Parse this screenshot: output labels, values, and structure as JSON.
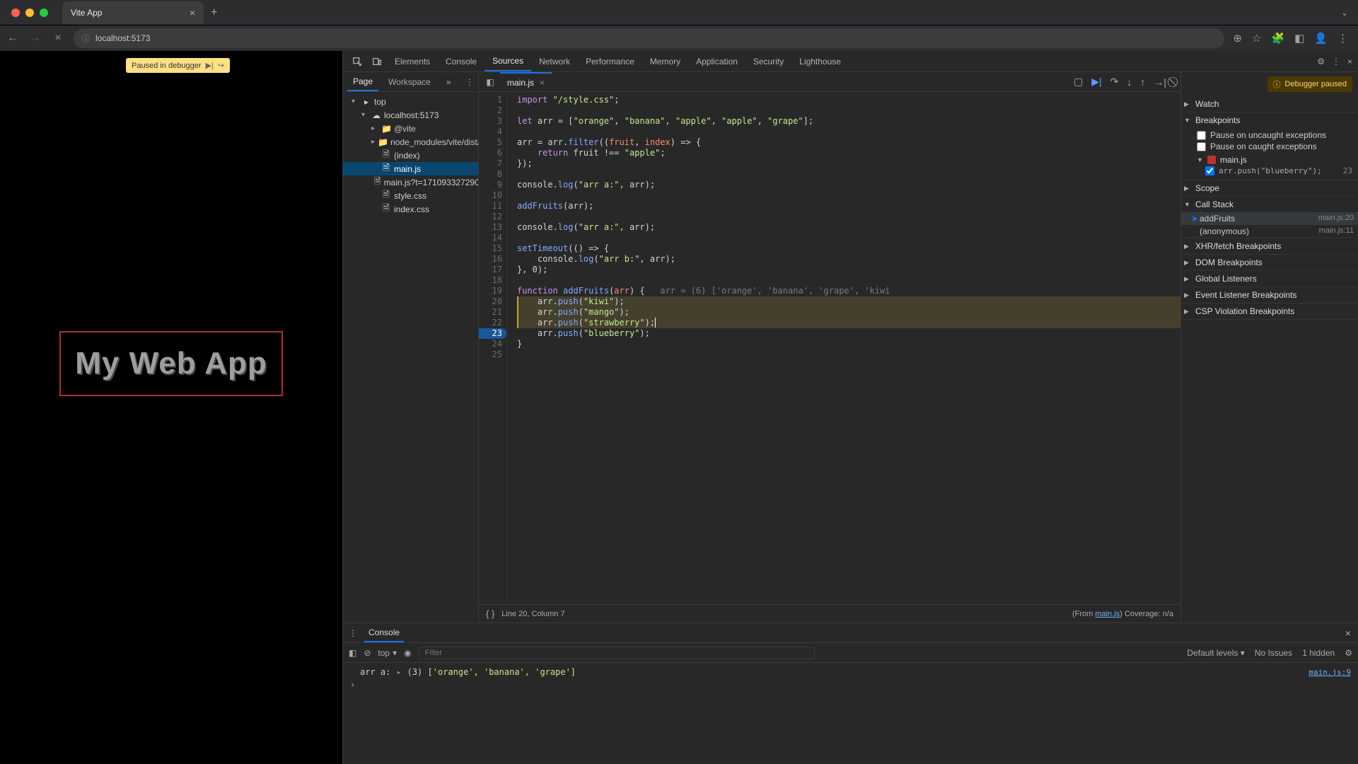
{
  "browser": {
    "tab_title": "Vite App",
    "url": "localhost:5173",
    "new_tab": "+"
  },
  "page": {
    "pause_badge": "Paused in debugger",
    "heading": "My Web App"
  },
  "devtools": {
    "tabs": [
      "Elements",
      "Console",
      "Sources",
      "Network",
      "Performance",
      "Memory",
      "Application",
      "Security",
      "Lighthouse"
    ],
    "active_tab": "Sources"
  },
  "sources_nav": {
    "tabs": [
      "Page",
      "Workspace"
    ],
    "more": "»",
    "tree": {
      "top": "top",
      "host": "localhost:5173",
      "vite_folder": "@vite",
      "node_modules": "node_modules/vite/dist/c",
      "files": [
        "(index)",
        "main.js",
        "main.js?t=171093327290",
        "style.css",
        "index.css"
      ],
      "selected": "main.js"
    }
  },
  "editor": {
    "tab": "main.js",
    "footer_pos": "Line 20, Column 7",
    "footer_from": "(From ",
    "footer_link": "main.js",
    "footer_cov": ") Coverage: n/a",
    "lines": [
      [
        {
          "t": "import ",
          "c": "kw"
        },
        {
          "t": "\"/style.css\"",
          "c": "str"
        },
        {
          "t": ";",
          "c": "ident"
        }
      ],
      [],
      [
        {
          "t": "let ",
          "c": "kw"
        },
        {
          "t": "arr = [",
          "c": "ident"
        },
        {
          "t": "\"orange\"",
          "c": "str"
        },
        {
          "t": ", ",
          "c": "ident"
        },
        {
          "t": "\"banana\"",
          "c": "str"
        },
        {
          "t": ", ",
          "c": "ident"
        },
        {
          "t": "\"apple\"",
          "c": "str"
        },
        {
          "t": ", ",
          "c": "ident"
        },
        {
          "t": "\"apple\"",
          "c": "str"
        },
        {
          "t": ", ",
          "c": "ident"
        },
        {
          "t": "\"grape\"",
          "c": "str"
        },
        {
          "t": "];",
          "c": "ident"
        }
      ],
      [],
      [
        {
          "t": "arr = arr.",
          "c": "ident"
        },
        {
          "t": "filter",
          "c": "fn"
        },
        {
          "t": "((",
          "c": "ident"
        },
        {
          "t": "fruit",
          "c": "param"
        },
        {
          "t": ", ",
          "c": "ident"
        },
        {
          "t": "index",
          "c": "param"
        },
        {
          "t": ") => {",
          "c": "ident"
        }
      ],
      [
        {
          "t": "    return ",
          "c": "kw"
        },
        {
          "t": "fruit !== ",
          "c": "ident"
        },
        {
          "t": "\"apple\"",
          "c": "str"
        },
        {
          "t": ";",
          "c": "ident"
        }
      ],
      [
        {
          "t": "});",
          "c": "ident"
        }
      ],
      [],
      [
        {
          "t": "console.",
          "c": "ident"
        },
        {
          "t": "log",
          "c": "fn"
        },
        {
          "t": "(",
          "c": "ident"
        },
        {
          "t": "\"arr a:\"",
          "c": "str"
        },
        {
          "t": ", arr);",
          "c": "ident"
        }
      ],
      [],
      [
        {
          "t": "addFruits",
          "c": "fn"
        },
        {
          "t": "(arr);",
          "c": "ident"
        }
      ],
      [],
      [
        {
          "t": "console.",
          "c": "ident"
        },
        {
          "t": "log",
          "c": "fn"
        },
        {
          "t": "(",
          "c": "ident"
        },
        {
          "t": "\"arr a:\"",
          "c": "str"
        },
        {
          "t": ", arr);",
          "c": "ident"
        }
      ],
      [],
      [
        {
          "t": "setTimeout",
          "c": "fn"
        },
        {
          "t": "(() => {",
          "c": "ident"
        }
      ],
      [
        {
          "t": "    console.",
          "c": "ident"
        },
        {
          "t": "log",
          "c": "fn"
        },
        {
          "t": "(",
          "c": "ident"
        },
        {
          "t": "\"arr b:\"",
          "c": "str"
        },
        {
          "t": ", arr);",
          "c": "ident"
        }
      ],
      [
        {
          "t": "}, 0);",
          "c": "ident"
        }
      ],
      [],
      [
        {
          "t": "function ",
          "c": "kw"
        },
        {
          "t": "addFruits",
          "c": "fn"
        },
        {
          "t": "(",
          "c": "ident"
        },
        {
          "t": "arr",
          "c": "param"
        },
        {
          "t": ") {   ",
          "c": "ident"
        },
        {
          "t": "arr = (6) ['orange', 'banana', 'grape', 'kiwi",
          "c": "hint"
        }
      ],
      [
        {
          "t": "    arr.",
          "c": "ident"
        },
        {
          "t": "push",
          "c": "fn"
        },
        {
          "t": "(",
          "c": "ident"
        },
        {
          "t": "\"kiwi\"",
          "c": "str"
        },
        {
          "t": ");",
          "c": "ident"
        }
      ],
      [
        {
          "t": "    arr.",
          "c": "ident"
        },
        {
          "t": "push",
          "c": "fn"
        },
        {
          "t": "(",
          "c": "ident"
        },
        {
          "t": "\"mango\"",
          "c": "str"
        },
        {
          "t": ");",
          "c": "ident"
        }
      ],
      [
        {
          "t": "    arr.",
          "c": "ident"
        },
        {
          "t": "push",
          "c": "fn"
        },
        {
          "t": "(",
          "c": "ident"
        },
        {
          "t": "\"strawberry\"",
          "c": "str"
        },
        {
          "t": ");",
          "c": "ident"
        }
      ],
      [
        {
          "t": "    arr.",
          "c": "ident"
        },
        {
          "t": "push",
          "c": "fn"
        },
        {
          "t": "(",
          "c": "ident"
        },
        {
          "t": "\"blueberry\"",
          "c": "str"
        },
        {
          "t": ");",
          "c": "ident"
        }
      ],
      [
        {
          "t": "}",
          "c": "ident"
        }
      ],
      []
    ],
    "exec_range": [
      20,
      22
    ],
    "cursor_line": 22,
    "breakpoint_line": 23
  },
  "debug": {
    "paused_badge": "Debugger paused",
    "sections": {
      "watch": "Watch",
      "breakpoints": "Breakpoints",
      "pause_uncaught": "Pause on uncaught exceptions",
      "pause_caught": "Pause on caught exceptions",
      "bp_file": "main.js",
      "bp_code": "arr.push(\"blueberry\");",
      "bp_line": "23",
      "scope": "Scope",
      "callstack": "Call Stack",
      "stack": [
        {
          "fn": "addFruits",
          "loc": "main.js:20",
          "current": true
        },
        {
          "fn": "(anonymous)",
          "loc": "main.js:11",
          "current": false
        }
      ],
      "xhr": "XHR/fetch Breakpoints",
      "dom": "DOM Breakpoints",
      "global": "Global Listeners",
      "event": "Event Listener Breakpoints",
      "csp": "CSP Violation Breakpoints"
    }
  },
  "console": {
    "tab": "Console",
    "context": "top",
    "filter_placeholder": "Filter",
    "levels": "Default levels",
    "no_issues": "No Issues",
    "hidden": "1 hidden",
    "log": {
      "label": "arr a:",
      "count": "(3)",
      "preview": "['orange', 'banana', 'grape']",
      "src": "main.js:9"
    }
  }
}
